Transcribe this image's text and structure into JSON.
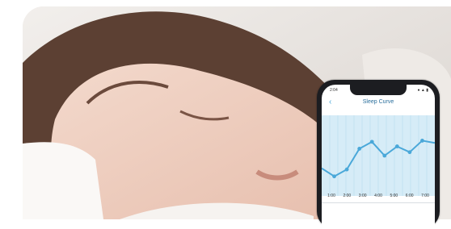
{
  "photo": {
    "subject": "sleeping-woman"
  },
  "phone": {
    "status_time": "2:04",
    "status_icons": "● ▲ ▮",
    "back_icon": "‹",
    "title": "Sleep Curve",
    "accent": "#4aa8d9"
  },
  "chart_data": {
    "type": "line",
    "x": [
      "1:00",
      "2:00",
      "3:00",
      "4:00",
      "5:00",
      "6:00",
      "7:00"
    ],
    "values": [
      4.8,
      3.4,
      4.6,
      8.2,
      9.4,
      7.0,
      8.6,
      7.6,
      9.6,
      9.2
    ],
    "x_ticks": [
      "1:00",
      "2:00",
      "3:00",
      "4:00",
      "5:00",
      "6:00",
      "7:00"
    ],
    "ylim": [
      0,
      14
    ],
    "grid": true
  }
}
